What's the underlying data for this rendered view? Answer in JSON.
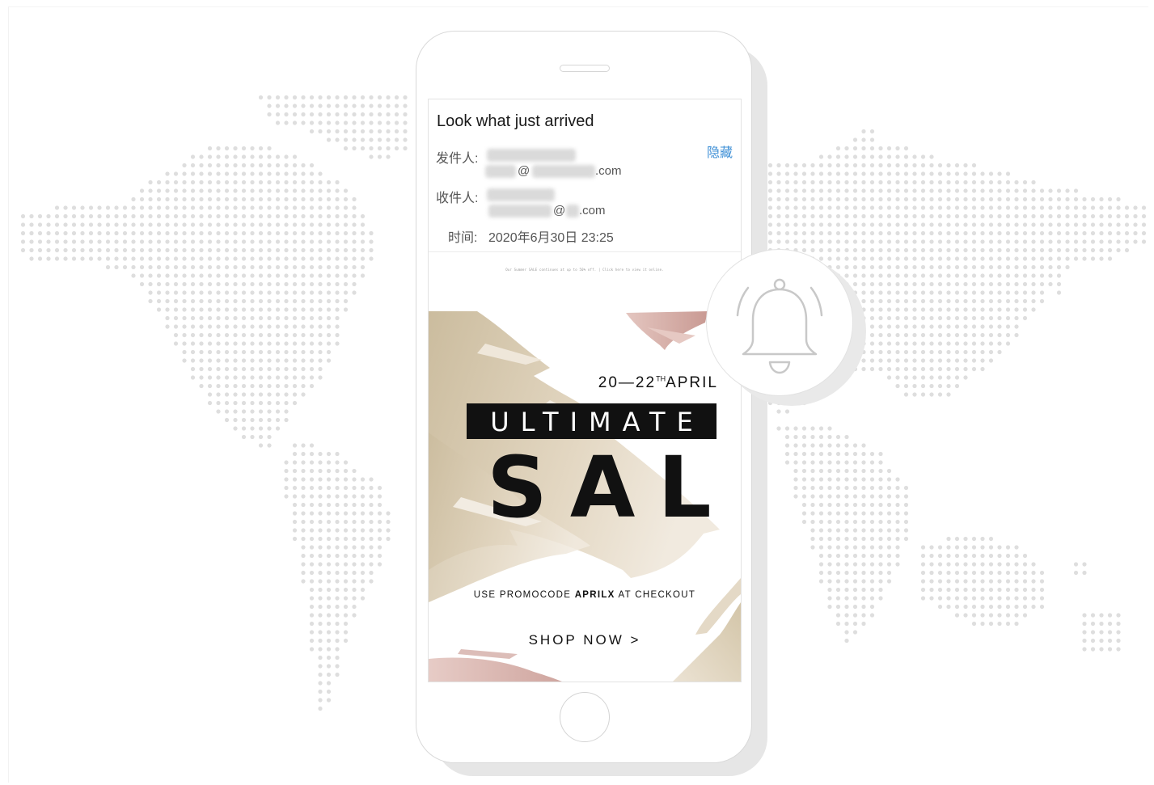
{
  "email": {
    "subject": "Look what just arrived",
    "hide_link": "隐藏",
    "from_label": "发件人:",
    "from_at": "@",
    "from_domain_suffix": ".com",
    "to_label": "收件人:",
    "to_at": "@",
    "to_domain_suffix": ".com",
    "time_label": "时间:",
    "time_value": "2020年6月30日 23:25",
    "preheader": "Our Summer SALE continues at up to 50% off. | Click here to view it online."
  },
  "banner": {
    "date_prefix": "20—22",
    "date_sup": "TH",
    "date_suffix": "APRIL",
    "ultimate": "ULTIMATE",
    "sale": "SALE",
    "promo_prefix": "USE PROMOCODE ",
    "promo_code": "APRILX",
    "promo_suffix": " AT CHECKOUT",
    "shop_now": "SHOP NOW >"
  },
  "icons": {
    "notification": "bell-icon",
    "phone": "smartphone",
    "background": "world-map-dots"
  },
  "colors": {
    "link": "#3d8fd6",
    "map_dots": "#dedede",
    "gold_brush": "#d8c9ad",
    "pink_brush": "#d4a9a3"
  }
}
